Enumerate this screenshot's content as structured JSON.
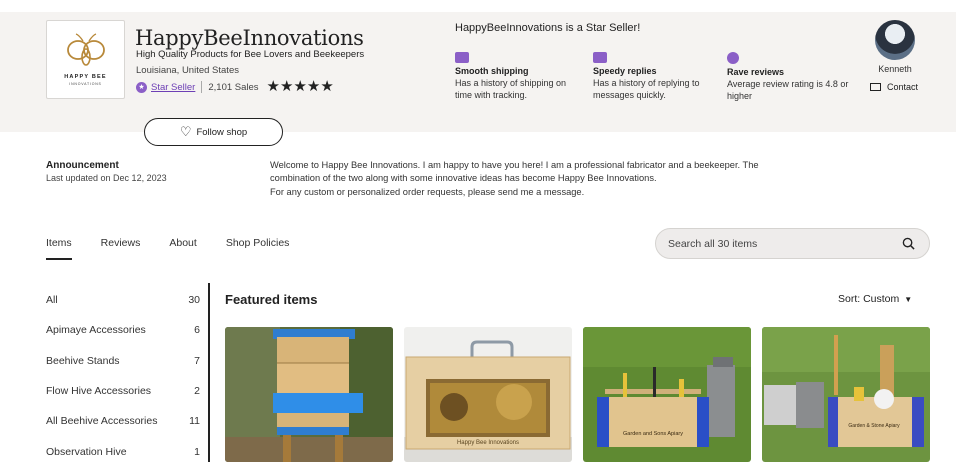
{
  "shop": {
    "logo_text": "HAPPY BEE",
    "logo_subtext": "INNOVATIONS",
    "name": "HappyBeeInnovations",
    "tagline": "High Quality Products for Bee Lovers and Beekeepers",
    "location": "Louisiana, United States",
    "star_seller_label": "Star Seller",
    "sales": "2,101 Sales",
    "rating_stars": "★★★★★",
    "follow_label": "Follow shop",
    "icons": {
      "heart": "heart-icon",
      "star_badge": "star-badge-icon"
    }
  },
  "star_seller": {
    "title": "HappyBeeInnovations is a Star Seller!",
    "features": [
      {
        "title": "Smooth shipping",
        "desc": "Has a history of shipping on time with tracking.",
        "icon": "truck-icon"
      },
      {
        "title": "Speedy replies",
        "desc": "Has a history of replying to messages quickly.",
        "icon": "envelope-icon"
      },
      {
        "title": "Rave reviews",
        "desc": "Average review rating is 4.8 or higher",
        "icon": "star-badge-icon"
      }
    ],
    "accent_color": "#8b5fc7"
  },
  "owner": {
    "name": "Kenneth",
    "contact_label": "Contact"
  },
  "announcement": {
    "title": "Announcement",
    "date": "Last updated on Dec 12, 2023",
    "line1": "Welcome to Happy Bee Innovations. I am happy to have you here! I am a professional fabricator and a beekeeper. The",
    "line2": "combination of the two along with some innovative ideas has become Happy Bee Innovations.",
    "line3": "For any custom or personalized order requests, please send me a message."
  },
  "tabs": [
    "Items",
    "Reviews",
    "About",
    "Shop Policies"
  ],
  "search": {
    "placeholder": "Search all 30 items"
  },
  "categories": [
    {
      "label": "All",
      "count": "30"
    },
    {
      "label": "Apimaye Accessories",
      "count": "6"
    },
    {
      "label": "Beehive Stands",
      "count": "7"
    },
    {
      "label": "Flow Hive Accessories",
      "count": "2"
    },
    {
      "label": "All Beehive Accessories",
      "count": "11"
    },
    {
      "label": "Observation Hive",
      "count": "1"
    }
  ],
  "featured": {
    "title": "Featured items",
    "sort_label": "Sort: Custom",
    "item_text_2": "Happy Bee Innovations",
    "item_text_3": "Garden and Sons Apiary",
    "item_text_4": "Garden & Stone Apiary"
  }
}
